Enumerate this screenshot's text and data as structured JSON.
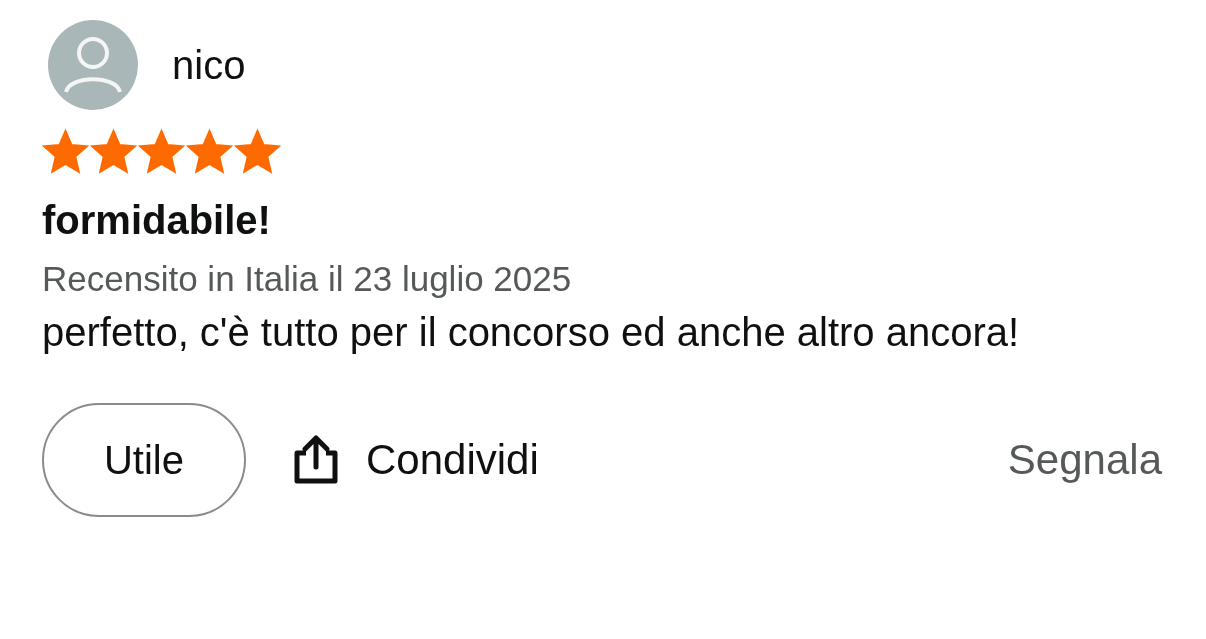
{
  "review": {
    "author": "nico",
    "stars": 5,
    "title": "formidabile!",
    "meta": "Recensito in Italia il 23 luglio 2025",
    "body": "perfetto, c'è tutto per il concorso ed anche altro ancora!",
    "helpful_button": "Utile",
    "share_button": "Condividi",
    "report_link": "Segnala"
  }
}
